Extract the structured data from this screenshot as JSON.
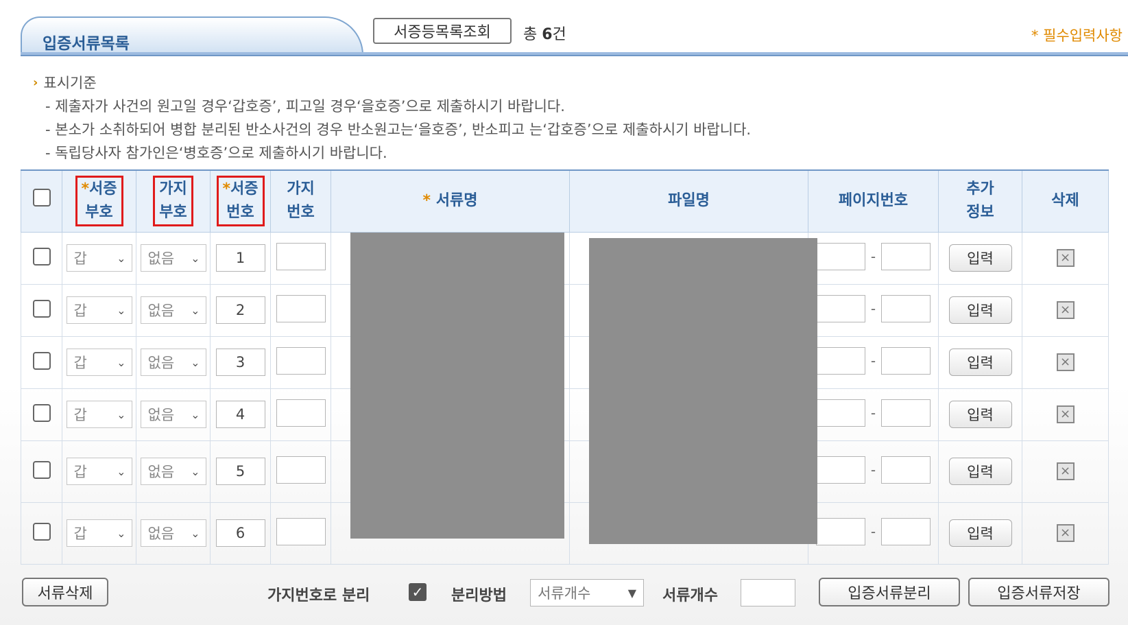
{
  "header": {
    "title": "입증서류목록",
    "lookup_button": "서증등목록조회",
    "total_prefix": "총 ",
    "total_count": "6",
    "total_suffix": "건",
    "required_note": "* 필수입력사항"
  },
  "criteria": {
    "heading": "표시기준",
    "lines": [
      "- 제출자가 사건의 원고일 경우‘갑호증’, 피고일 경우‘을호증’으로 제출하시기 바랍니다.",
      "- 본소가 소취하되어 병합 분리된 반소사건의 경우 반소원고는‘을호증’, 반소피고 는‘갑호증’으로 제출하시기 바랍니다.",
      "- 독립당사자 참가인은‘병호증’으로 제출하시기 바랍니다."
    ]
  },
  "table": {
    "headers": {
      "evidence_sign_a": "서증",
      "evidence_sign_b": "부호",
      "branch_sign_a": "가지",
      "branch_sign_b": "부호",
      "evidence_no_a": "서증",
      "evidence_no_b": "번호",
      "branch_no_a": "가지",
      "branch_no_b": "번호",
      "doc_name": "서류명",
      "file_name": "파일명",
      "page_no": "페이지번호",
      "extra_a": "추가",
      "extra_b": "정보",
      "delete": "삭제"
    },
    "required_mark": "*",
    "rows": [
      {
        "sign": "갑",
        "branch": "없음",
        "number": "1",
        "input": "입력"
      },
      {
        "sign": "갑",
        "branch": "없음",
        "number": "2",
        "input": "입력"
      },
      {
        "sign": "갑",
        "branch": "없음",
        "number": "3",
        "input": "입력"
      },
      {
        "sign": "갑",
        "branch": "없음",
        "number": "4",
        "input": "입력"
      },
      {
        "sign": "갑",
        "branch": "없음",
        "number": "5",
        "input": "입력"
      },
      {
        "sign": "갑",
        "branch": "없음",
        "number": "6",
        "input": "입력"
      }
    ]
  },
  "footer": {
    "delete_docs": "서류삭제",
    "split_by_branch": "가지번호로 분리",
    "split_method_label": "분리방법",
    "split_method_value": "서류개수",
    "doc_count_label": "서류개수",
    "split_button": "입증서류분리",
    "save_button": "입증서류저장"
  },
  "colors": {
    "accent": "#2a5d96",
    "required": "#e08a00",
    "highlight_box": "#e01b1b"
  }
}
